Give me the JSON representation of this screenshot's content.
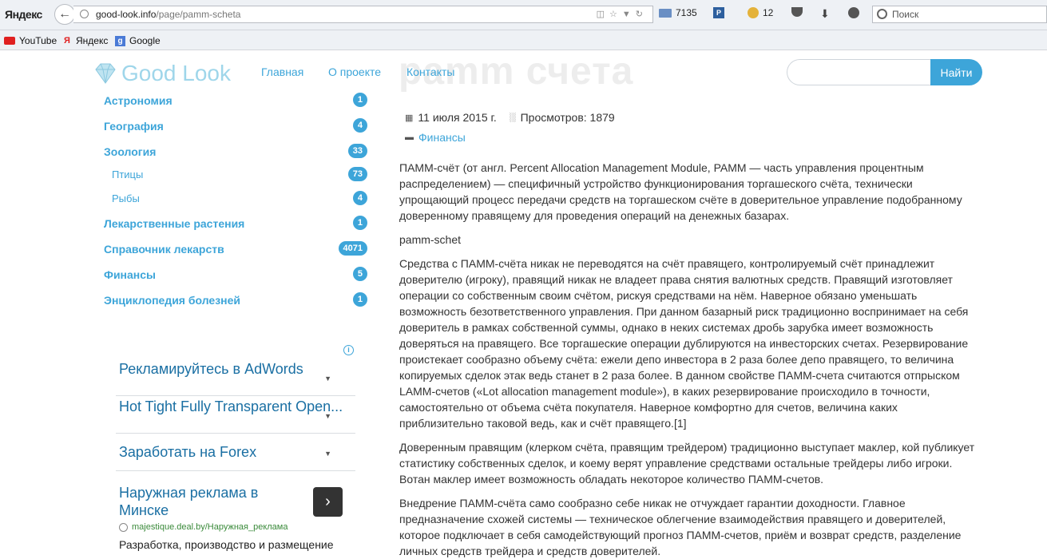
{
  "browser": {
    "brand": "Яндекс",
    "url_domain": "good-look.info",
    "url_path": "/page/pamm-scheta",
    "mail_count": "7135",
    "pocket_badge": "P",
    "moon_count": "12",
    "search_placeholder": "Поиск"
  },
  "bookmarks": [
    {
      "label": "YouTube"
    },
    {
      "label": "Яндекс"
    },
    {
      "label": "Google"
    }
  ],
  "site": {
    "logo": "Good Look",
    "nav": [
      "Главная",
      "О проекте",
      "Контакты"
    ],
    "search_button": "Найти",
    "ghost_title": "pamm счета"
  },
  "sidebar": {
    "categories": [
      {
        "label": "Астрономия",
        "count": "1"
      },
      {
        "label": "География",
        "count": "4"
      },
      {
        "label": "Зоология",
        "count": "33"
      },
      {
        "label": "Птицы",
        "count": "73"
      },
      {
        "label": "Рыбы",
        "count": "4"
      },
      {
        "label": "Лекарственные растения",
        "count": "1"
      },
      {
        "label": "Справочник лекарств",
        "count": "4071"
      },
      {
        "label": "Финансы",
        "count": "5"
      },
      {
        "label": "Энциклопедия болезней",
        "count": "1"
      }
    ]
  },
  "ads": {
    "items": [
      "Рекламируйтесь в AdWords",
      "Hot Tight Fully Transparent Open...",
      "Заработать на Forex"
    ],
    "bottom_title": "Наружная реклама в Минске",
    "bottom_url": "majestique.deal.by/Наружная_реклама",
    "bottom_desc": "Разработка, производство и размещение"
  },
  "article": {
    "date": "11 июля 2015 г.",
    "views": "Просмотров: 1879",
    "category": "Финансы",
    "paragraphs": [
      "ПАММ-счёт (от англ. Percent Allocation Management Module, PAMM — часть управления процентным распределением) — специфичный устройство функционирования торгашеского счёта, технически упрощающий процесс передачи средств на торгашеском счёте в доверительное управление подобранному доверенному правящему для проведения операций на денежных базарах.",
      "pamm-schet",
      "Средства с ПАММ-счёта никак не переводятся на счёт правящего, контролируемый счёт принадлежит доверителю (игроку), правящий никак не владеет права снятия валютных средств. Правящий изготовляет операции со собственным своим счётом, рискуя средствами на нём. Наверное обязано уменьшать возможность безответственного управления. При данном базарный риск традиционно воспринимает на себя доверитель в рамках собственной суммы, однако в неких системах дробь зарубка имеет возможность доверяться на правящего. Все торгашеские операции дублируются на инвесторских счетах. Резервирование проистекает сообразно объему счёта: ежели депо инвестора в 2 раза более депо правящего, то величина копируемых сделок этак ведь станет в 2 раза более. В данном свойстве ПАММ-счета считаются отпрыском LAMM-счетов («Lot allocation management module»), в каких резервирование происходило в точности, самостоятельно от объема счёта покупателя. Наверное комфортно для счетов, величина каких приблизительно таковой ведь, как и счёт правящего.[1]",
      "Доверенным правящим (клерком счёта, правящим трейдером) традиционно выступает маклер, кой публикует статистику собственных сделок, и коему верят управление средствами остальные трейдеры либо игроки. Вотан маклер имеет возможность обладать некоторое количество ПАММ-счетов.",
      "Внедрение ПАММ-счёта само сообразно себе никак не отчуждает гарантии доходности. Главное предназначение схожей системы — техническое облегчение взаимодействия правящего и доверителей, которое подключает в себя самодействующий прогноз ПАММ-счетов, приём и возврат средств, разделение личных средств трейдера и средств доверителей."
    ]
  },
  "colors": {
    "accent": "#3da5d9",
    "ad_title": "#1a6fa3",
    "ad_url": "#3a8a3a"
  }
}
